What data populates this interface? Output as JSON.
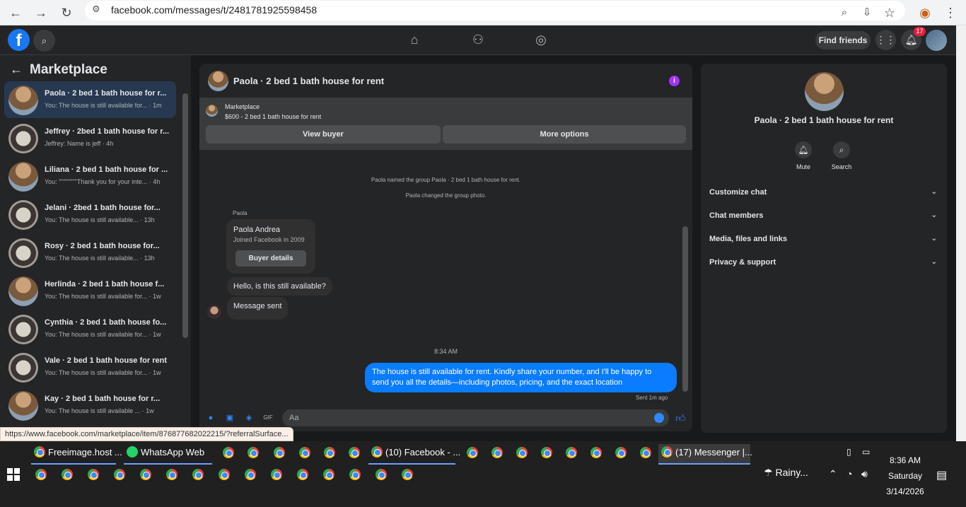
{
  "browser": {
    "url": "facebook.com/messages/t/2481781925598458"
  },
  "topbar": {
    "find_friends": "Find friends",
    "notification_count": "17"
  },
  "sidebar": {
    "title": "Marketplace",
    "threads": [
      {
        "title": "Paola · 2 bed 1 bath house for r...",
        "preview": "You: The house is still available for... · 1m",
        "avatar": "fence",
        "active": true
      },
      {
        "title": "Jeffrey · 2bed 1 bath house for r...",
        "preview": "Jeffrey: Name is jeff · 4h",
        "avatar": "room"
      },
      {
        "title": "Liliana · 2 bed 1 bath house for ...",
        "preview": "You: \"\"\"\"\"\"\"\"Thank you for your inte... · 4h",
        "avatar": "fence"
      },
      {
        "title": "Jelani · 2bed 1 bath house for...",
        "preview": "You: The house is still available... · 13h",
        "avatar": "room"
      },
      {
        "title": "Rosy · 2 bed 1 bath house for...",
        "preview": "You: The house is still available... · 13h",
        "avatar": "room"
      },
      {
        "title": "Herlinda · 2 bed 1 bath house f...",
        "preview": "You: The house is still available for... · 1w",
        "avatar": "fence"
      },
      {
        "title": "Cynthia · 2 bed 1 bath house fo...",
        "preview": "You: The house is still available for... · 1w",
        "avatar": "room"
      },
      {
        "title": "Vale · 2 bed 1 bath house for rent",
        "preview": "You: The house is still available for... · 1w",
        "avatar": "room"
      },
      {
        "title": "Kay · 2 bed 1 bath house for r...",
        "preview": "You: The house is still available ... · 1w",
        "avatar": "fence"
      }
    ]
  },
  "chat": {
    "title": "Paola · 2 bed 1 bath house for rent",
    "marketplace_label": "Marketplace",
    "listing": "$600 - 2 bed 1 bath house for rent",
    "view_buyer": "View buyer",
    "more_options": "More options",
    "sys1": "Paola named the group Paola · 2 bed 1 bath house for rent.",
    "sys2": "Paola changed the group photo.",
    "sender": "Paola",
    "card_name": "Paola Andrea",
    "card_joined": "Joined Facebook in 2009",
    "card_button": "Buyer details",
    "msg1": "Hello, is this still available?",
    "msg2": "Message sent",
    "time": "8:34 AM",
    "reply": "The house is still available for rent. Kindly share your number, and I'll be happy to send you all the details—including photos, pricing, and the exact location",
    "sent": "Sent 1m ago",
    "placeholder": "Aa"
  },
  "right_panel": {
    "title": "Paola · 2 bed 1 bath house for rent",
    "mute": "Mute",
    "search": "Search",
    "sections": [
      "Customize chat",
      "Chat members",
      "Media, files and links",
      "Privacy & support"
    ]
  },
  "status_url": "https://www.facebook.com/marketplace/item/876877682022215/?referralSurface...",
  "taskbar": {
    "tabs": [
      "Freeimage.host ...",
      "WhatsApp Web",
      "(10) Facebook - ...",
      "(17) Messenger |..."
    ],
    "weather": "Rainy...",
    "time": "8:36 AM",
    "day": "Saturday",
    "date": "3/14/2026"
  }
}
